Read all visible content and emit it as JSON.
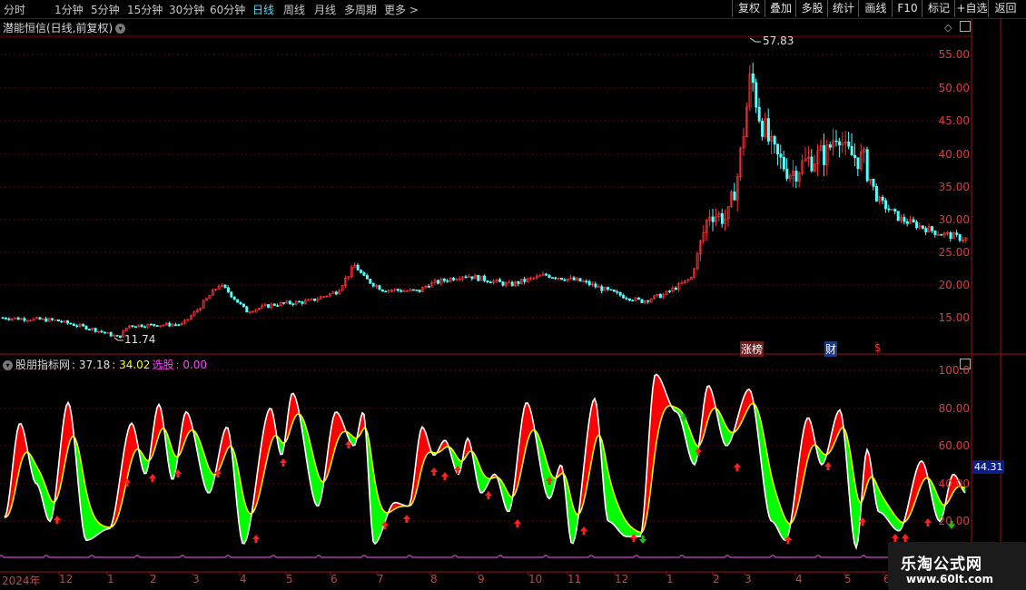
{
  "toolbar": {
    "periods": [
      "分时",
      "1分钟",
      "5分钟",
      "15分钟",
      "30分钟",
      "60分钟",
      "日线",
      "周线",
      "月线",
      "多周期",
      "更多 >"
    ],
    "active_period": "日线",
    "buttons": [
      "复权",
      "叠加",
      "多股",
      "统计",
      "画线",
      "F10",
      "标记",
      "+自选",
      "返回"
    ]
  },
  "main_chart": {
    "title": "潜能恒信(日线,前复权)",
    "high_label": "57.83",
    "low_label": "11.74",
    "y_ticks": [
      "55.00",
      "50.00",
      "45.00",
      "40.00",
      "35.00",
      "30.00",
      "25.00",
      "20.00",
      "15.00"
    ],
    "badges": {
      "zhangbang": "涨榜",
      "cai": "财",
      "s": "$"
    }
  },
  "indicator": {
    "name": "股朋指标网",
    "value1": ": 37.18",
    "value2": ": 34.02",
    "xuangu_label": "选股",
    "xuangu_value": ": 0.00",
    "y_ticks": [
      "100.0",
      "80.00",
      "60.00",
      "40.00",
      "20.00"
    ],
    "current_value": "44.31"
  },
  "x_axis": {
    "labels": [
      "2024年",
      "12",
      "1",
      "2",
      "3",
      "4",
      "5",
      "6",
      "7",
      "8",
      "9",
      "10",
      "11",
      "12",
      "1",
      "2",
      "3",
      "4",
      "5",
      "6"
    ]
  },
  "watermark": {
    "line1": "乐淘公式网",
    "line2": "www.60lt.com"
  },
  "colors": {
    "up": "#ff3333",
    "down": "#54ffff",
    "red_fill": "#ff0000",
    "green_fill": "#00ff00",
    "yellow": "#ffff00",
    "purple": "#cc44cc"
  }
}
